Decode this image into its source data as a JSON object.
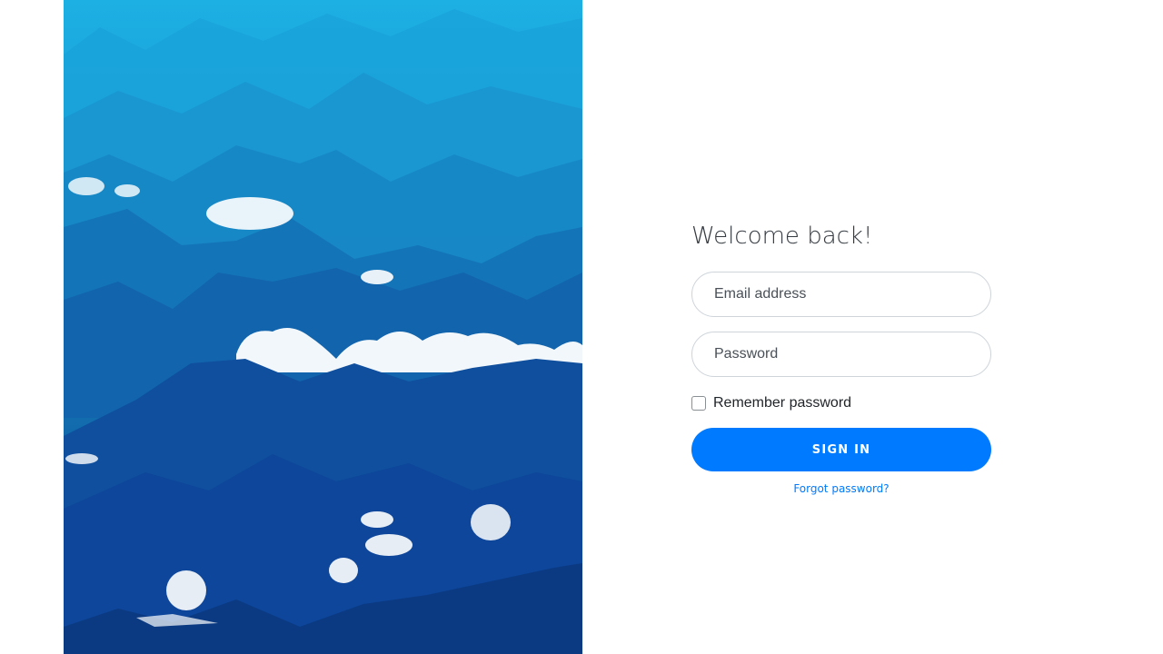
{
  "login": {
    "title": "Welcome back!",
    "email_placeholder": "Email address",
    "password_placeholder": "Password",
    "remember_label": "Remember password",
    "remember_checked": false,
    "signin_label": "SIGN IN",
    "forgot_label": "Forgot password?"
  },
  "colors": {
    "accent": "#007bff",
    "title_text": "#343a40",
    "field_border": "#ced4da"
  },
  "hero": {
    "image_subject": "mountains-and-clouds-image"
  }
}
